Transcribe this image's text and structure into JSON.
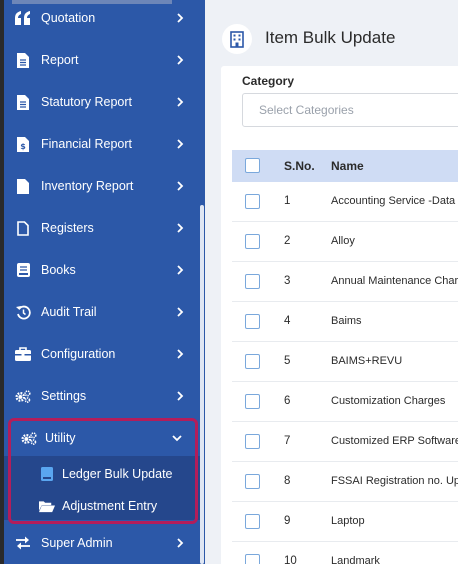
{
  "sidebar": {
    "items": [
      {
        "label": "Quotation",
        "icon": "quote-icon"
      },
      {
        "label": "Report",
        "icon": "document-icon"
      },
      {
        "label": "Statutory Report",
        "icon": "document-icon"
      },
      {
        "label": "Financial Report",
        "icon": "invoice-icon"
      },
      {
        "label": "Inventory Report",
        "icon": "file-icon"
      },
      {
        "label": "Registers",
        "icon": "file-outline-icon"
      },
      {
        "label": "Books",
        "icon": "book-icon"
      },
      {
        "label": "Audit Trail",
        "icon": "history-icon"
      },
      {
        "label": "Configuration",
        "icon": "toolbox-icon"
      },
      {
        "label": "Settings",
        "icon": "cogs-icon"
      },
      {
        "label": "Utility",
        "icon": "cogs-icon",
        "expanded": true
      },
      {
        "label": "Super Admin",
        "icon": "exchange-icon"
      }
    ],
    "utility_submenu": [
      {
        "label": "Ledger Bulk Update",
        "icon": "ledger-icon"
      },
      {
        "label": "Adjustment Entry",
        "icon": "folder-open-icon"
      }
    ]
  },
  "header": {
    "title": "Item Bulk Update",
    "icon": "building-icon"
  },
  "filter": {
    "category_label": "Category",
    "category_placeholder": "Select Categories"
  },
  "table": {
    "columns": [
      "S.No.",
      "Name"
    ],
    "rows": [
      {
        "sno": "1",
        "name": "Accounting Service -Data En"
      },
      {
        "sno": "2",
        "name": "Alloy"
      },
      {
        "sno": "3",
        "name": "Annual Maintenance Charg"
      },
      {
        "sno": "4",
        "name": "Baims"
      },
      {
        "sno": "5",
        "name": "BAIMS+REVU"
      },
      {
        "sno": "6",
        "name": "Customization Charges"
      },
      {
        "sno": "7",
        "name": "Customized ERP Software"
      },
      {
        "sno": "8",
        "name": "FSSAI Registration no. Upd"
      },
      {
        "sno": "9",
        "name": "Laptop"
      },
      {
        "sno": "10",
        "name": "Landmark"
      }
    ]
  },
  "colors": {
    "sidebar": "#2c58a8",
    "submenu": "#25478c",
    "highlight": "#b31d5a",
    "table_header": "#cfdcf4",
    "checkbox": "#7aa8dc"
  }
}
